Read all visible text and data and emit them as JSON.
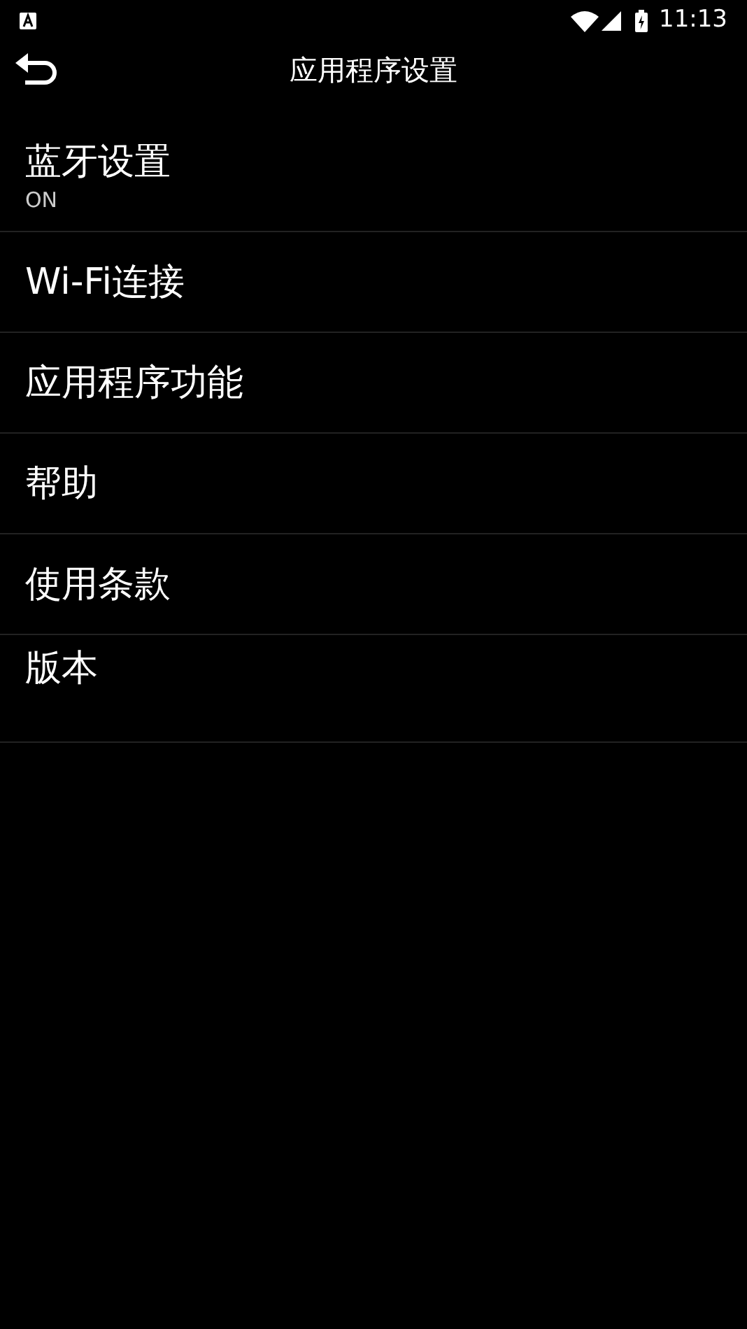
{
  "status_bar": {
    "time": "11:13"
  },
  "toolbar": {
    "title": "应用程序设置"
  },
  "settings": [
    {
      "kind": "summary",
      "title": "蓝牙设置",
      "summary": "ON"
    },
    {
      "kind": "single",
      "title": "Wi-Fi连接"
    },
    {
      "kind": "single",
      "title": "应用程序功能"
    },
    {
      "kind": "single",
      "title": "帮助"
    },
    {
      "kind": "single",
      "title": "使用条款"
    },
    {
      "kind": "tall",
      "title": "版本"
    }
  ]
}
